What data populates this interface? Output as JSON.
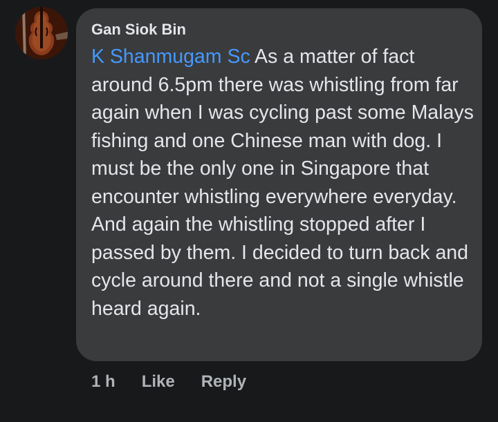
{
  "comment": {
    "author": "Gan Siok Bin",
    "avatar_icon": "violin-icon",
    "mention": "K Shanmugam Sc",
    "text": " As a matter of fact around 6.5pm there was whistling from far again when I was cycling past some Malays fishing and one Chinese man with dog. I must be the only one in Singapore that encounter whistling everywhere everyday. And again the whistling stopped after I passed by them. I decided to turn back and cycle around there and not a single whistle heard again."
  },
  "actions": {
    "time": "1 h",
    "like_label": "Like",
    "reply_label": "Reply"
  },
  "colors": {
    "background": "#18191a",
    "bubble": "#3a3b3c",
    "text": "#e4e6eb",
    "mention": "#4599ff",
    "secondary": "#b0b3b8"
  }
}
